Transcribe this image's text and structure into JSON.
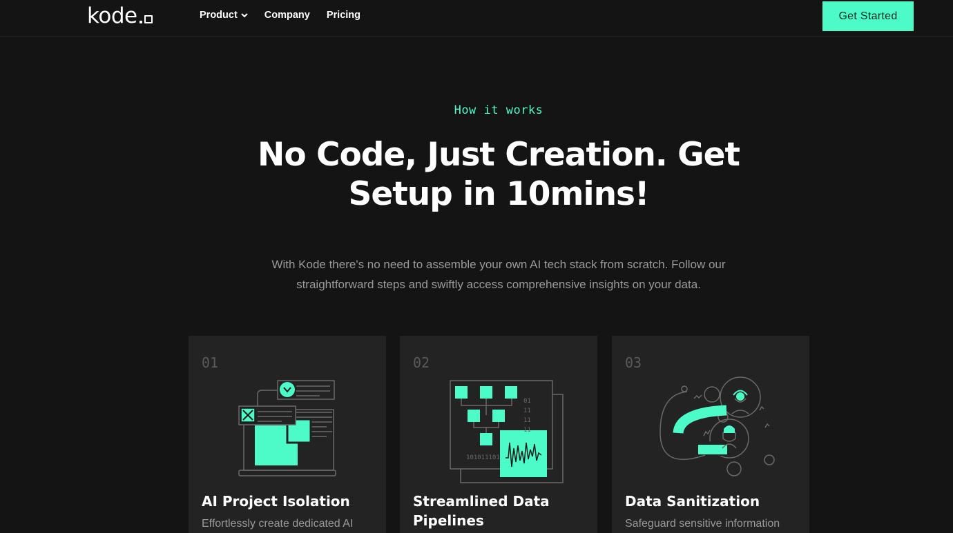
{
  "brand": {
    "logo": "kode"
  },
  "nav": {
    "links": [
      {
        "label": "Product"
      },
      {
        "label": "Company"
      },
      {
        "label": "Pricing"
      }
    ],
    "cta_label": "Get Started"
  },
  "hero": {
    "eyebrow": "How it works",
    "headline": "No Code, Just Creation. Get Setup in 10mins!",
    "subtitle": "With Kode there's no need to assemble your own AI tech stack from scratch. Follow our straightforward steps and swiftly access comprehensive insights on your data."
  },
  "cards": [
    {
      "number": "01",
      "title": "AI Project Isolation",
      "description": "Effortlessly create dedicated AI"
    },
    {
      "number": "02",
      "title": "Streamlined Data Pipelines",
      "description": ""
    },
    {
      "number": "03",
      "title": "Data Sanitization",
      "description": "Safeguard sensitive information"
    }
  ],
  "illustration_text": {
    "binary_bottom": "101011101",
    "binary_side": [
      "01",
      "11",
      "11",
      "11"
    ]
  },
  "colors": {
    "accent": "#4dfbc8",
    "background": "#141414",
    "card_background": "#232323",
    "muted_text": "#9a9a9a",
    "line_art": "#6a6a6a"
  }
}
